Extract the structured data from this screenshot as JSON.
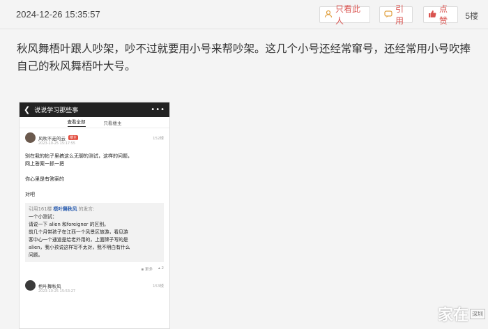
{
  "header": {
    "timestamp": "2024-12-26 15:35:57",
    "only_author_label": "只看此人",
    "quote_label": "引用",
    "like_label": "点赞",
    "floor_label": "5楼"
  },
  "post": {
    "text": "秋风舞梧叶跟人吵架，吵不过就要用小号来帮吵架。这几个小号还经常窜号，还经常用小号吹捧自己的秋风舞梧叶大号。"
  },
  "screenshot": {
    "nav_title": "说说学习那些事",
    "tabs": [
      "查看全部",
      "只看楼主"
    ],
    "user1": {
      "name": "风吹不走的云",
      "badge": "楼主",
      "count": "152楼",
      "date": "2023-10-25 15:17:55"
    },
    "body_lines": [
      "别在我的帖子里搞这么无聊的测试，这样的问题，",
      "网上答案一抓一把",
      "",
      "你心里是有答案的",
      "",
      "对吧"
    ],
    "quote": {
      "head_prefix": "引用161楼",
      "head_name": "梧叶舞秋风",
      "head_suffix": "的发言:",
      "lines": [
        "一个小测试：",
        "请说一下 alien 和foreigner 的区别。",
        "前几个月带孩子在江西一个风景区旅游，看见游",
        "客中心一个通道是给老外用的，上面牌子写的是",
        "alien，我小孩说这样写不太对，我不明白有什么",
        "问题。"
      ]
    },
    "actions": [
      "更多",
      "2"
    ],
    "user2": {
      "name": "梧叶舞秋风",
      "count": "153楼",
      "date": "2023-10-25 15:53:27"
    }
  },
  "watermark": {
    "text": "家在",
    "sub": "深圳"
  },
  "colors": {
    "accent": "#d9534f",
    "quote_name": "#2a5db0"
  }
}
